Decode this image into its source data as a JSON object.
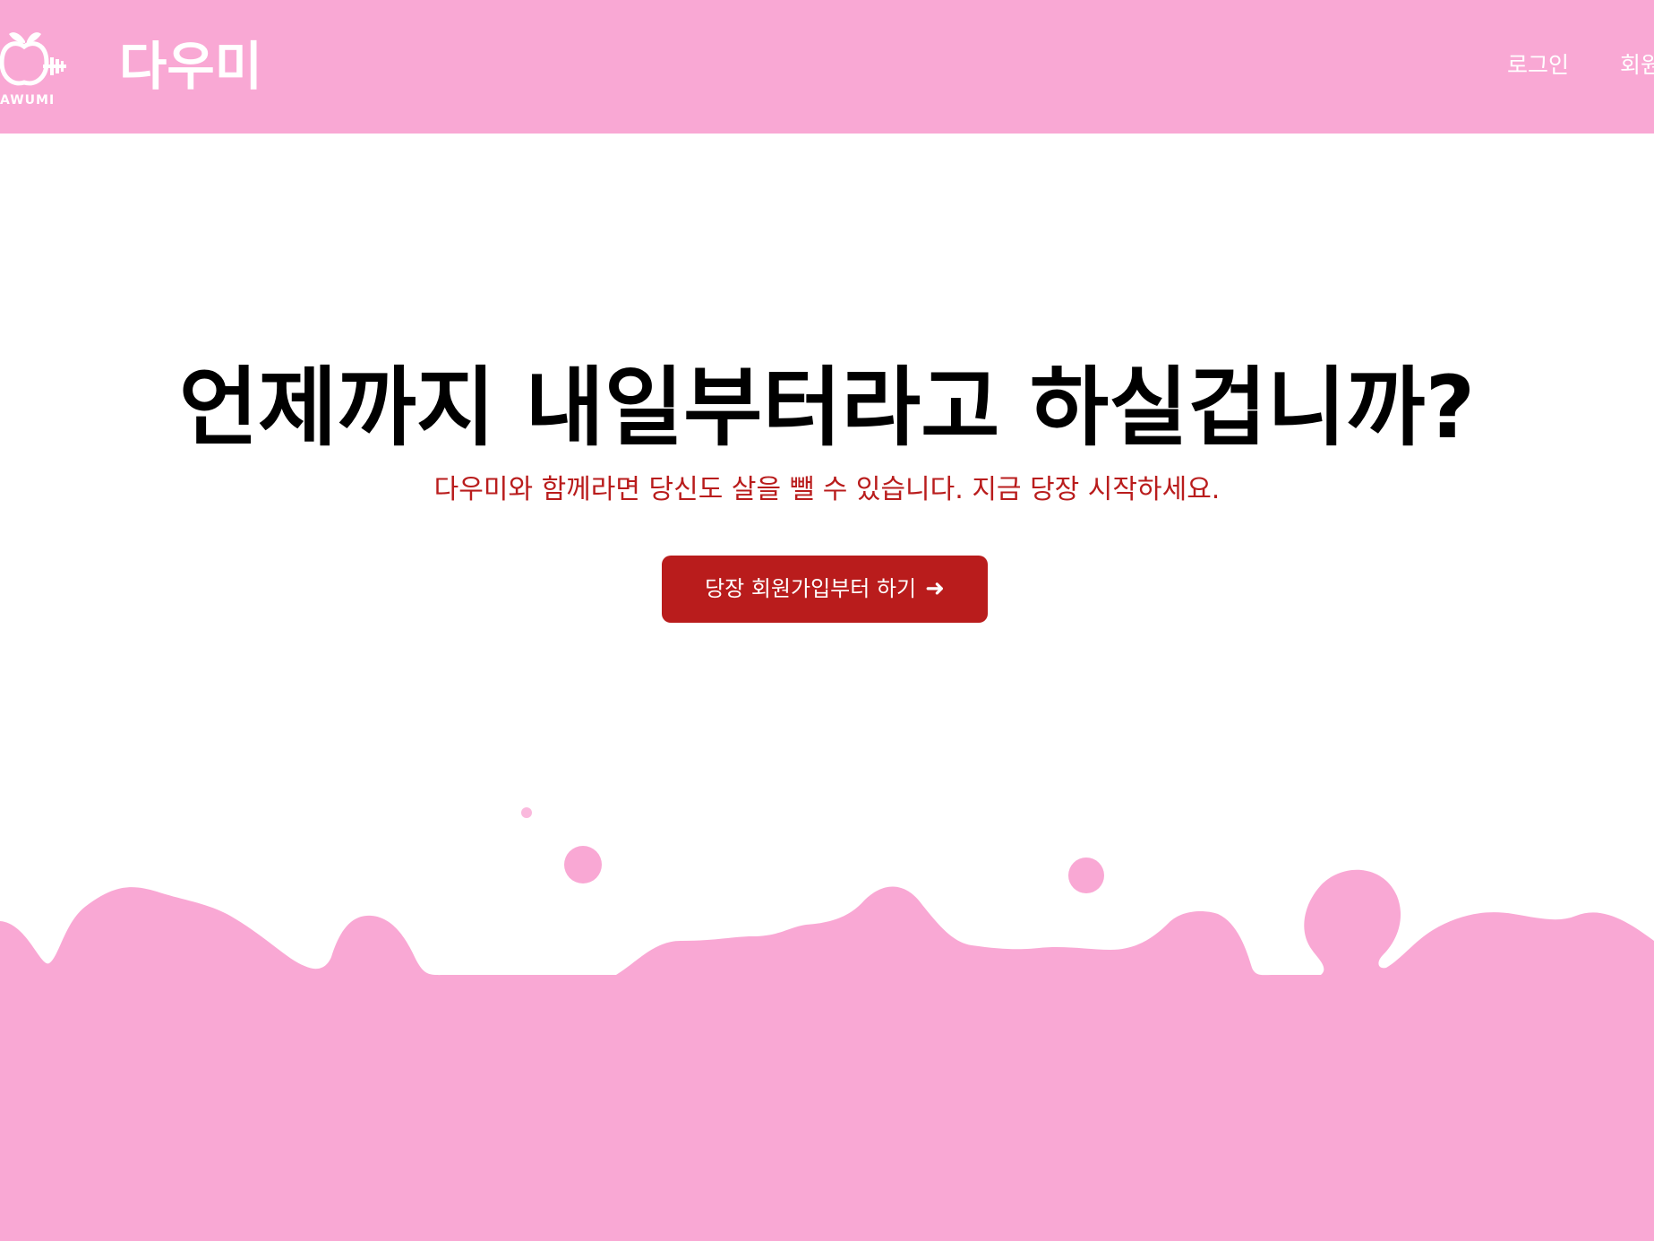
{
  "navbar": {
    "logo_caption": "AWUMI",
    "brand": "다우미",
    "links": [
      {
        "label": "로그인"
      },
      {
        "label": "회원가입"
      }
    ]
  },
  "hero": {
    "title": "언제까지 내일부터라고 하실겁니까?",
    "subtitle": "다우미와 함께라면 당신도 살을 뺄 수 있습니다. 지금 당장 시작하세요.",
    "cta_label": "당장 회원가입부터 하기",
    "cta_icon": "arrow-right-icon",
    "cta_arrow": "➜"
  },
  "colors": {
    "primary_pink": "#f9a8d4",
    "accent_red": "#b91c1c",
    "text_dark": "#000000",
    "white": "#ffffff"
  }
}
